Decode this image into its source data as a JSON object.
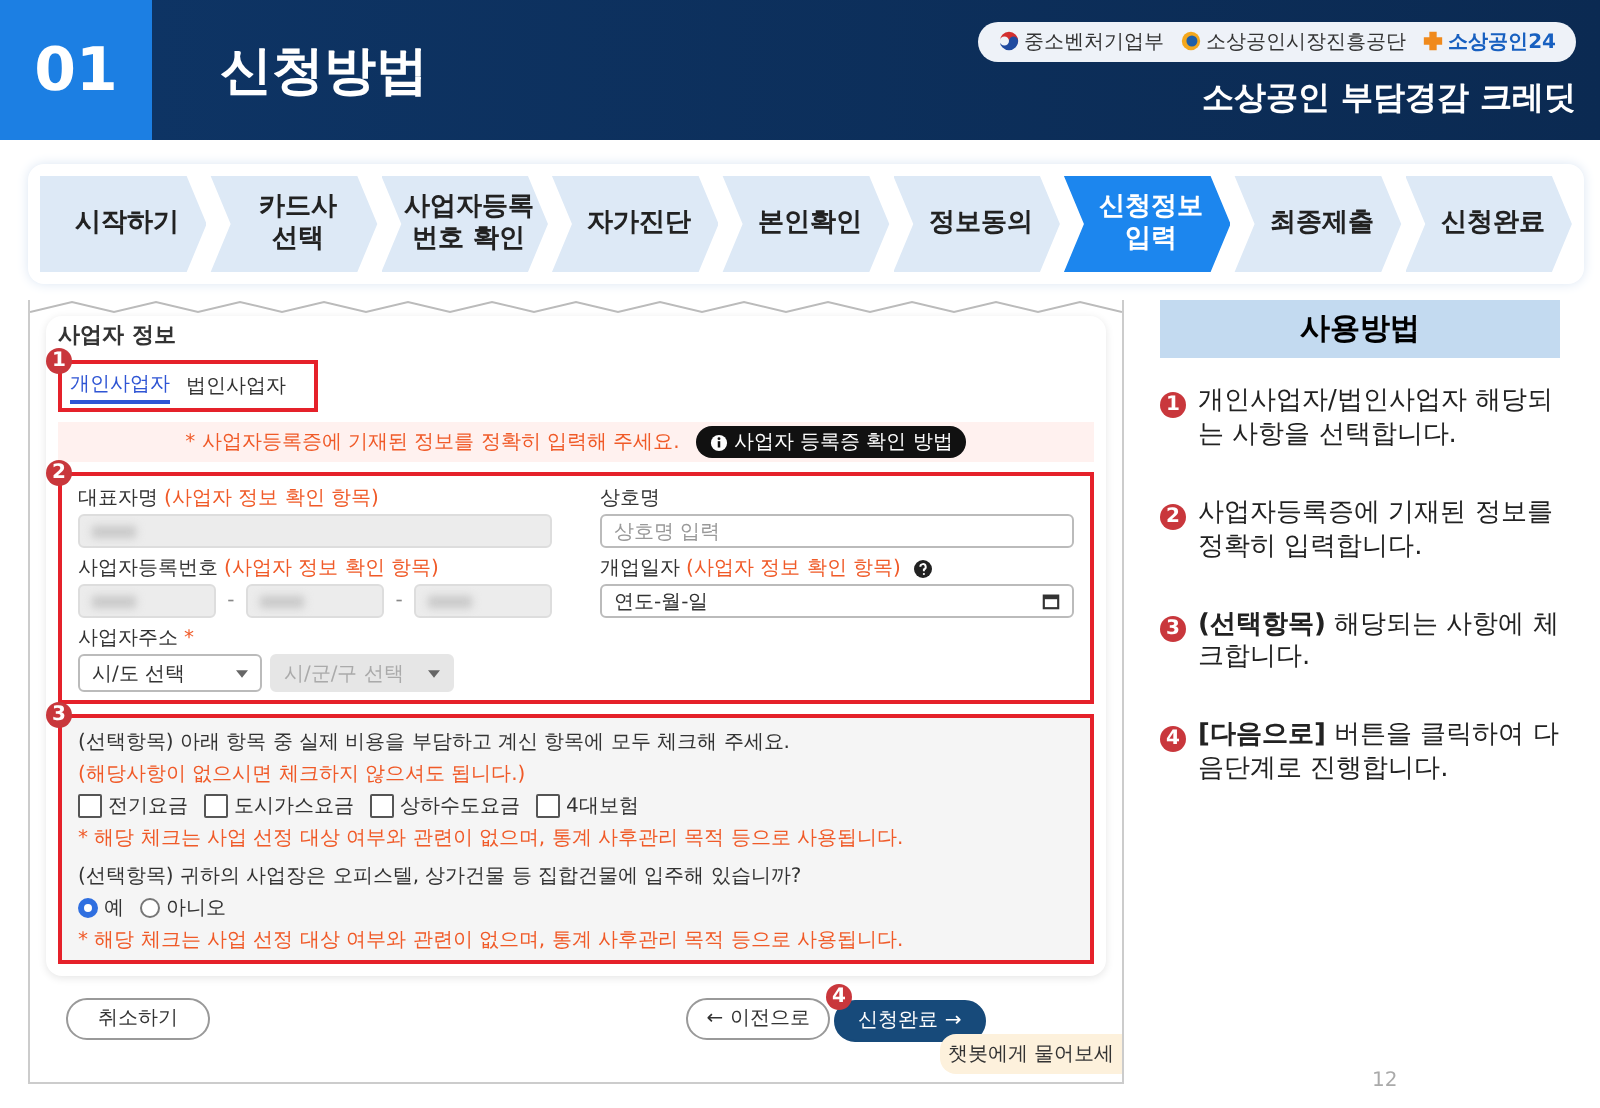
{
  "header": {
    "number": "01",
    "title": "신청방법",
    "logos": [
      "중소벤처기업부",
      "소상공인시장진흥공단",
      "소상공인24"
    ],
    "subtitle": "소상공인 부담경감 크레딧"
  },
  "steps": [
    {
      "label": "시작하기",
      "selected": false
    },
    {
      "label": "카드사\n선택",
      "selected": false
    },
    {
      "label": "사업자등록\n번호 확인",
      "selected": false
    },
    {
      "label": "자가진단",
      "selected": false
    },
    {
      "label": "본인확인",
      "selected": false
    },
    {
      "label": "정보동의",
      "selected": false
    },
    {
      "label": "신청정보\n입력",
      "selected": true
    },
    {
      "label": "최종제출",
      "selected": false
    },
    {
      "label": "신청완료",
      "selected": false
    }
  ],
  "form": {
    "section_title": "사업자 정보",
    "tabs_marker": "1",
    "fields_marker": "2",
    "options_marker": "3",
    "submit_marker": "4",
    "tabs": [
      {
        "label": "개인사업자",
        "selected": true
      },
      {
        "label": "법인사업자",
        "selected": false
      }
    ],
    "notice": "* 사업자등록증에 기재된 정보를 정확히 입력해 주세요.",
    "notice_button": "사업자 등록증 확인 방법",
    "fields": [
      {
        "kind": "text",
        "label": "대표자명",
        "hint": "(사업자 정보 확인 항목)",
        "disabled": true
      },
      {
        "kind": "text",
        "label": "상호명",
        "placeholder": "상호명 입력",
        "disabled": false
      },
      {
        "kind": "bizno",
        "label": "사업자등록번호",
        "hint": "(사업자 정보 확인 항목)",
        "separator": "-",
        "disabled": true
      },
      {
        "kind": "date",
        "label": "개업일자",
        "hint": "(사업자 정보 확인 항목)",
        "placeholder": "연도-월-일",
        "disabled": false
      },
      {
        "kind": "address",
        "label": "사업자주소",
        "required": "*",
        "selects": [
          {
            "placeholder": "시/도 선택",
            "disabled": false
          },
          {
            "placeholder": "시/군/구 선택",
            "disabled": true
          }
        ]
      }
    ],
    "question1": "(선택항목) 아래 항목 중 실제 비용을 부담하고 계신 항목에 모두 체크해 주세요.",
    "question1_hint": "(해당사항이 없으시면 체크하지 않으셔도 됩니다.)",
    "checkboxes": [
      {
        "label": "전기요금",
        "checked": false
      },
      {
        "label": "도시가스요금",
        "checked": false
      },
      {
        "label": "상하수도요금",
        "checked": false
      },
      {
        "label": "4대보험",
        "checked": false
      }
    ],
    "note1": "* 해당 체크는 사업 선정 대상 여부와 관련이 없으며, 통계 사후관리 목적 등으로 사용됩니다.",
    "question2": "(선택항목) 귀하의 사업장은 오피스텔, 상가건물 등 집합건물에 입주해 있습니까?",
    "radios": [
      {
        "label": "예",
        "selected": true
      },
      {
        "label": "아니오",
        "selected": false
      }
    ],
    "note2": "* 해당 체크는 사업 선정 대상 여부와 관련이 없으며, 통계 사후관리 목적 등으로 사용됩니다.",
    "cancel_button": "취소하기",
    "prev_button": "← 이전으로",
    "submit_button": "신청완료 →",
    "chatbot": "챗봇에게 물어보세"
  },
  "instructions": {
    "title": "사용방법",
    "items": [
      {
        "number": "1",
        "text": "개인사업자/법인사업자 해당되는 사항을 선택합니다."
      },
      {
        "number": "2",
        "text": "사업자등록증에 기재된 정보를 정확히 입력합니다."
      },
      {
        "number": "3",
        "text": "**(선택항목)** 해당되는 사항에 체크합니다."
      },
      {
        "number": "4",
        "text": "**[다음으로]** 버튼을 클릭하여 다음단계로 진행합니다."
      }
    ]
  },
  "page_number": "12"
}
